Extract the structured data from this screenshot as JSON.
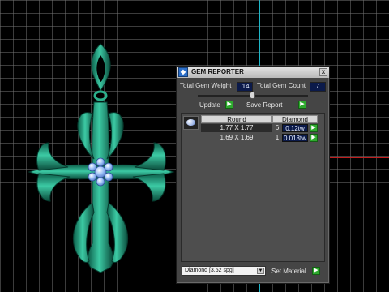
{
  "panel": {
    "title": "GEM REPORTER",
    "close_glyph": "x",
    "total_weight_label": "Total Gem Weight",
    "total_weight_value": ".14",
    "total_count_label": "Total Gem Count",
    "total_count_value": "7",
    "update_label": "Update",
    "save_report_label": "Save Report",
    "arrow_glyph": "▶",
    "table": {
      "headers": [
        "Round",
        "Diamond"
      ],
      "rows": [
        {
          "size": "1.77 X 1.77",
          "count": "6",
          "weight": "0.12tw"
        },
        {
          "size": "1.69 X 1.69",
          "count": "1",
          "weight": "0.018tw"
        }
      ]
    },
    "material_value": "Diamond     [3.52 spg]",
    "set_material_label": "Set Material"
  },
  "colors": {
    "accent_green": "#2eaa2e",
    "value_bg": "#0b1a4a",
    "model_green": "#1f9a7c",
    "gem_blue": "#7fa8ee"
  },
  "icons": {
    "app": "gem-reporter-icon",
    "gem": "round-stone-icon",
    "close": "close-icon",
    "arrow": "green-arrow-icon",
    "caret": "chevron-down-icon"
  }
}
